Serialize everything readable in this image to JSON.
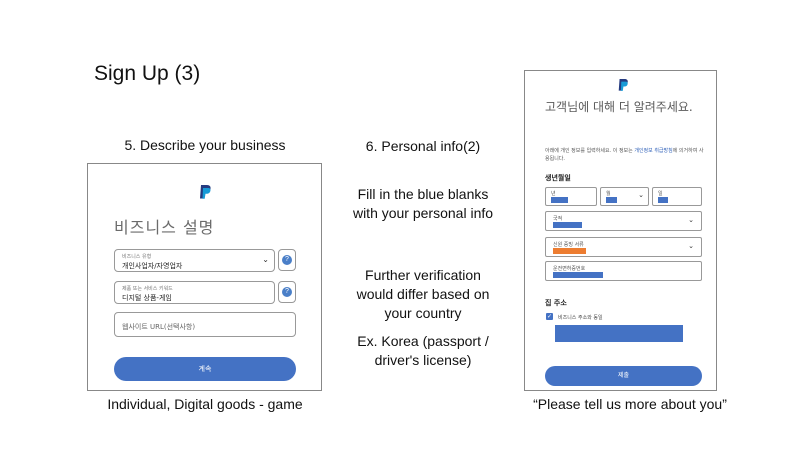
{
  "slide": {
    "title": "Sign Up (3)",
    "step5_caption": "5. Describe your business",
    "step6_caption": "6. Personal info(2)",
    "note_fill": "Fill in the blue blanks\nwith your personal info",
    "note_verification": "Further verification\nwould differ based on\nyour country",
    "note_korea": "Ex. Korea (passport /\ndriver's license)",
    "left_footer": "Individual, Digital goods - game",
    "right_footer": "“Please tell us more about you”"
  },
  "business_form": {
    "heading": "비즈니스 설명",
    "business_type_label": "비즈니스 유형",
    "business_type_value": "개인사업자/자영업자",
    "keyword_label": "제품 또는 서비스 키워드",
    "keyword_value": "디지털 상품-게임",
    "website_placeholder": "웹사이트 URL(선택사항)",
    "continue_button": "계속",
    "help_icon": "?"
  },
  "personal_form": {
    "heading": "고객님에 대해 더 알려주세요.",
    "description_pre": "아래에 개인 정보를 입력하세요. 이 정보는 ",
    "description_link": "개인정보 취급방침",
    "description_post": "에 의거하여 사용됩니다.",
    "dob_label": "생년월일",
    "year_label": "년",
    "month_label": "월",
    "day_label": "일",
    "nationality_label": "국적",
    "id_type_label": "신원 증빙 서류",
    "license_label": "운전면허증번호",
    "address_label": "집 주소",
    "same_address_label": "비즈니스 주소와 동일",
    "submit_button": "제출",
    "colors": {
      "fill": "#4472c4",
      "highlight": "#ed7d31"
    }
  }
}
